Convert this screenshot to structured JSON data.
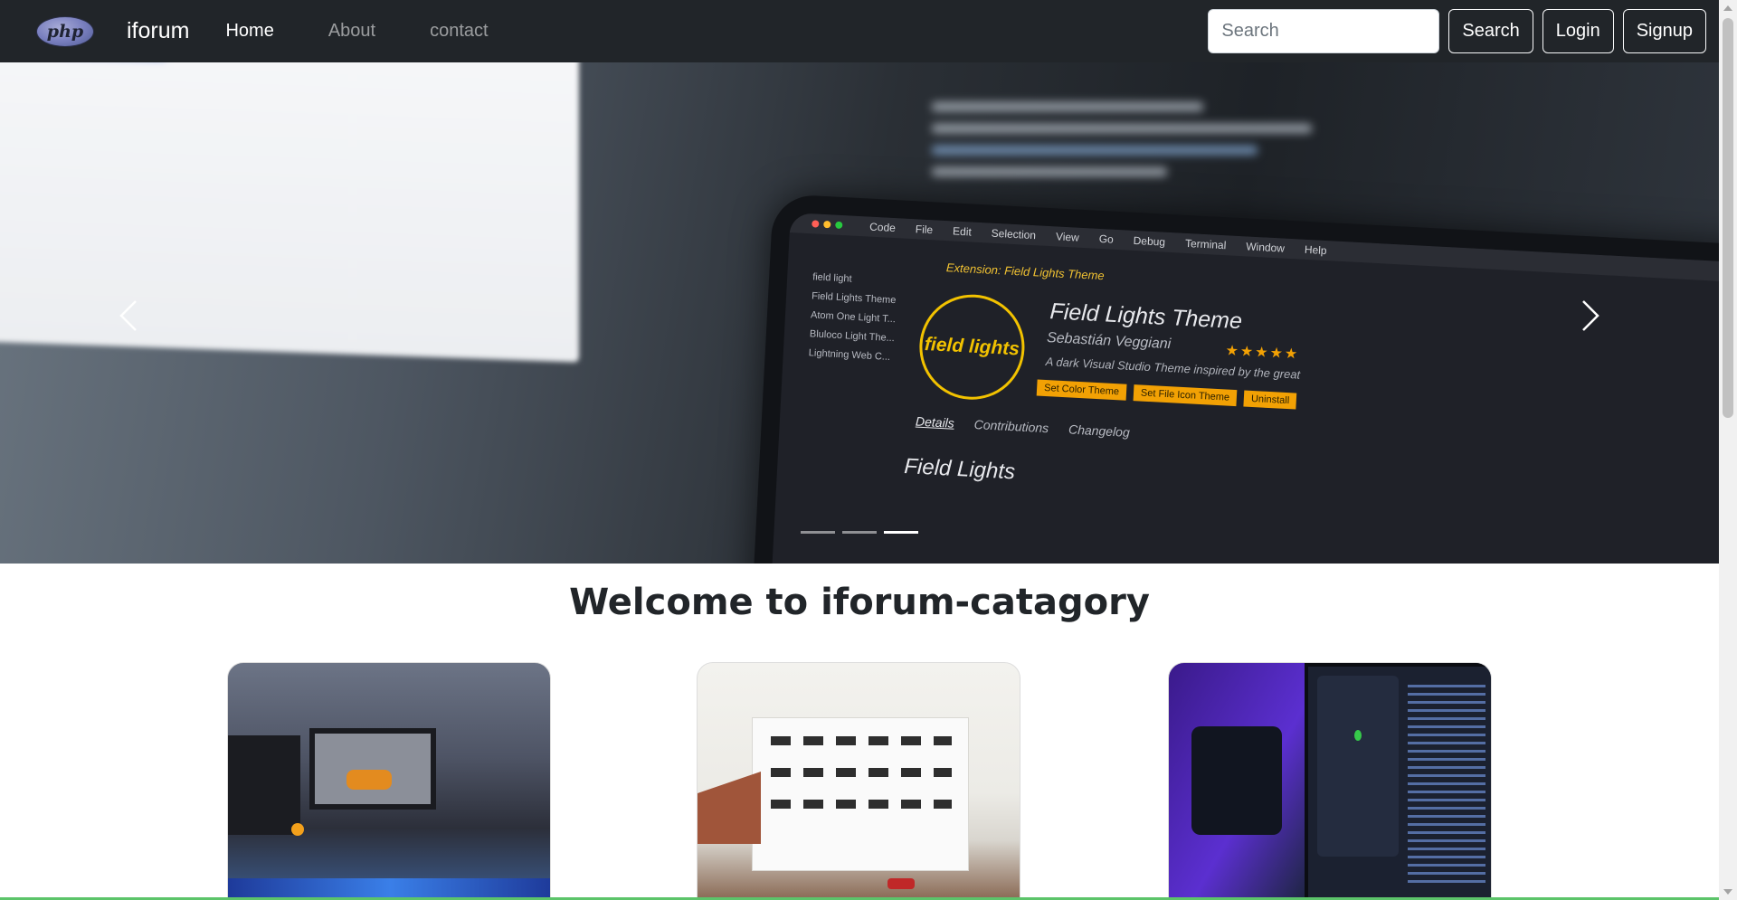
{
  "navbar": {
    "logo_text": "php",
    "brand": "iforum",
    "links": [
      {
        "label": "Home",
        "active": true
      },
      {
        "label": "About",
        "active": false
      },
      {
        "label": "contact",
        "active": false
      }
    ],
    "search": {
      "placeholder": "Search",
      "value": ""
    },
    "search_button": "Search",
    "login_button": "Login",
    "signup_button": "Signup"
  },
  "carousel": {
    "slide_count": 3,
    "active_slide": 3,
    "slide": {
      "menu_items": [
        "Code",
        "File",
        "Edit",
        "Selection",
        "View",
        "Go",
        "Debug",
        "Terminal",
        "Window",
        "Help"
      ],
      "tab_title": "Extension: Field Lights Theme",
      "list_items": [
        "field light",
        "Field Lights Theme",
        "Atom One Light T...",
        "Bluloco Light The...",
        "Lightning Web C..."
      ],
      "logo_text": "field lights",
      "theme_name": "Field Lights Theme",
      "author": "Sebastián Veggiani",
      "rating_stars": "★★★★★",
      "description": "A dark Visual Studio Theme inspired by the great",
      "buttons": [
        "Set Color Theme",
        "Set File Icon Theme",
        "Uninstall"
      ],
      "tabs": [
        "Details",
        "Contributions",
        "Changelog"
      ],
      "heading": "Field Lights"
    }
  },
  "main": {
    "heading": "Welcome to iforum-catagory"
  },
  "colors": {
    "navbar_bg": "#212529",
    "accent_green": "#5cc46a"
  }
}
